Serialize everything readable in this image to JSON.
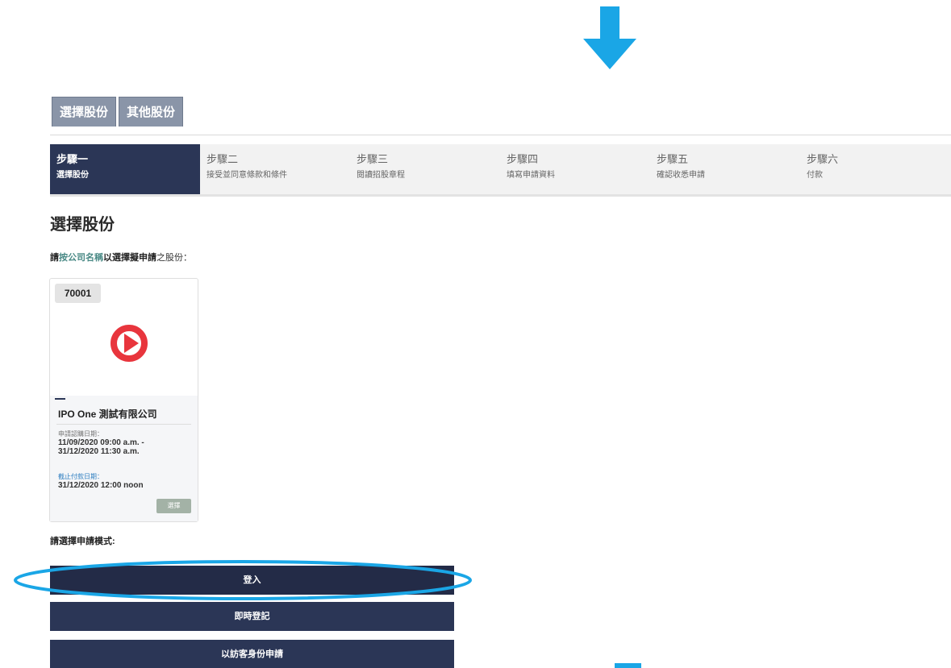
{
  "colors": {
    "brand_navy": "#2b3656",
    "annotation_blue": "#1aa6e6",
    "logo_red": "#e8353d"
  },
  "stock_tabs": [
    {
      "label": "選擇股份"
    },
    {
      "label": "其他股份"
    }
  ],
  "steps": [
    {
      "number": "步驟一",
      "desc": "選擇股份",
      "active": true
    },
    {
      "number": "步驟二",
      "desc": "接受並同意條款和條件",
      "active": false
    },
    {
      "number": "步驟三",
      "desc": "閱讀招股章程",
      "active": false
    },
    {
      "number": "步驟四",
      "desc": "填寫申請資料",
      "active": false
    },
    {
      "number": "步驟五",
      "desc": "確認收悉申請",
      "active": false
    },
    {
      "number": "步驟六",
      "desc": "付款",
      "active": false
    }
  ],
  "page_title": "選擇股份",
  "instruction": {
    "prefix": "請",
    "link": "按公司名稱",
    "middle": "以選擇擬申請",
    "suffix": "之股份："
  },
  "stock_card": {
    "code": "70001",
    "logo_icon": "play-circle-icon",
    "company_name": "IPO One 測試有限公司",
    "subscription_label": "申請認購日期：",
    "subscription_start": "11/09/2020 09:00 a.m. -",
    "subscription_end": "31/12/2020 11:30 a.m.",
    "payment_label": "截止付款日期：",
    "payment_deadline": "31/12/2020 12:00 noon",
    "select_label": "選擇"
  },
  "mode_label": "請選擇申請模式:",
  "mode_buttons": {
    "login": "登入",
    "instant_register": "即時登記",
    "guest": "以訪客身份申請"
  }
}
